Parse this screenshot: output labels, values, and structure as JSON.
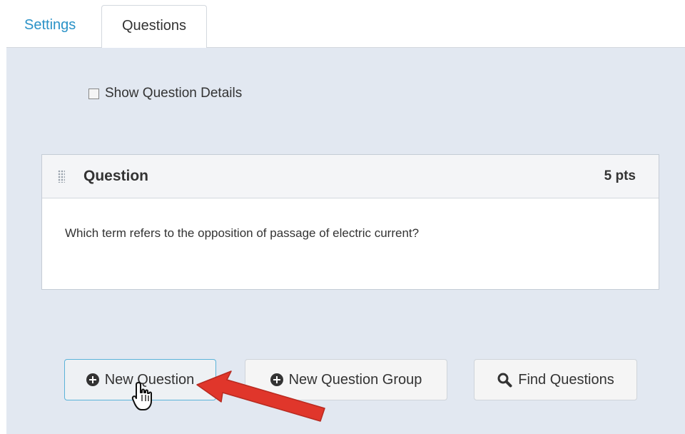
{
  "tabs": {
    "settings": "Settings",
    "questions": "Questions"
  },
  "options": {
    "show_details_label": "Show Question Details",
    "show_details_checked": false
  },
  "question": {
    "title": "Question",
    "points": "5 pts",
    "text": "Which term refers to the opposition of passage of electric current?"
  },
  "actions": {
    "new_question": "New Question",
    "new_question_group": "New Question Group",
    "find_questions": "Find Questions"
  },
  "colors": {
    "panel_bg": "#e2e8f1",
    "link_blue": "#2a92c7",
    "arrow_red": "#e0362b"
  },
  "icons": {
    "plus": "plus-circle-icon",
    "search": "search-icon",
    "cursor": "hand-pointer-icon",
    "drag": "drag-handle-icon"
  }
}
